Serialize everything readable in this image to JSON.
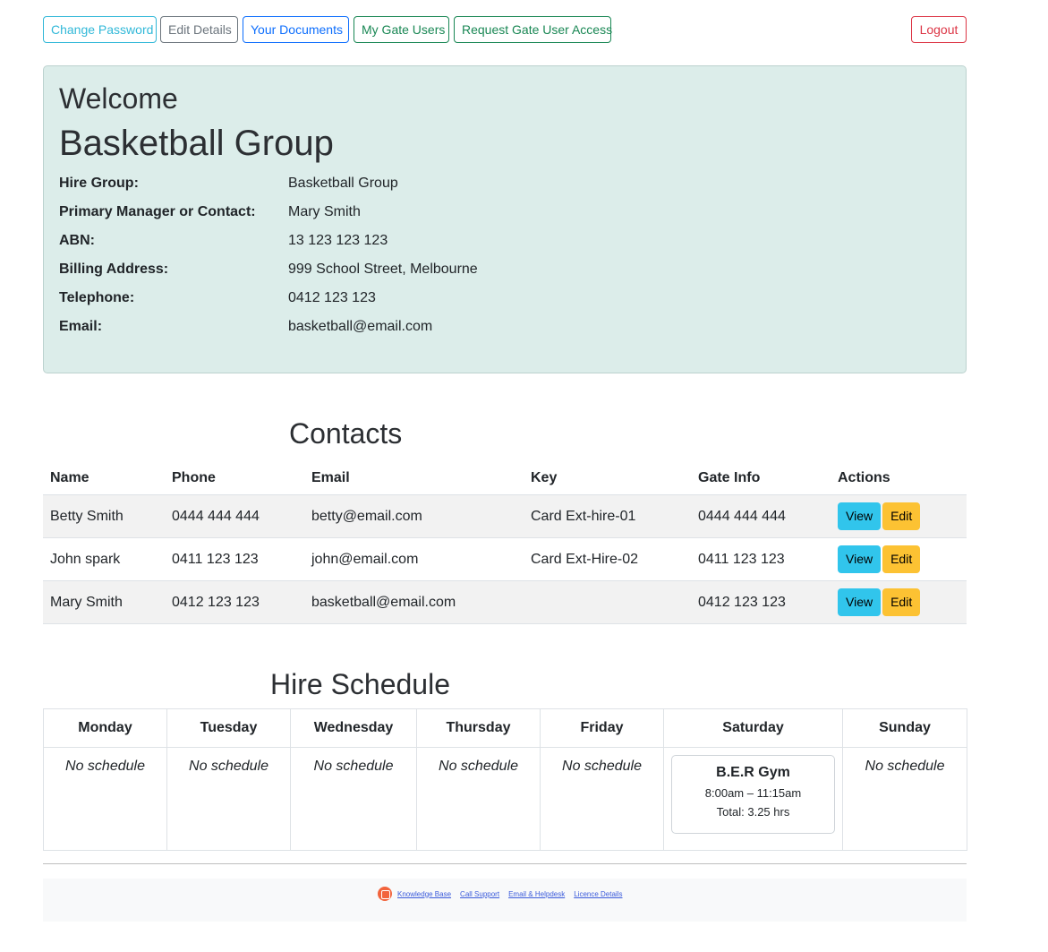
{
  "nav": {
    "change_password": "Change Password",
    "edit_details": "Edit Details",
    "your_documents": "Your Documents",
    "my_gate_users": "My Gate Users",
    "request_gate_access": "Request Gate User Access",
    "logout": "Logout"
  },
  "welcome": {
    "heading": "Welcome",
    "group_name": "Basketball Group",
    "fields": [
      {
        "label": "Hire Group:",
        "value": "Basketball Group"
      },
      {
        "label": "Primary Manager or Contact:",
        "value": "Mary Smith"
      },
      {
        "label": "ABN:",
        "value": "13 123 123 123"
      },
      {
        "label": "Billing Address:",
        "value": "999 School Street, Melbourne"
      },
      {
        "label": "Telephone:",
        "value": "0412 123 123"
      },
      {
        "label": "Email:",
        "value": "basketball@email.com"
      }
    ]
  },
  "contacts": {
    "title": "Contacts",
    "headers": [
      "Name",
      "Phone",
      "Email",
      "Key",
      "Gate Info",
      "Actions"
    ],
    "rows": [
      {
        "name": "Betty Smith",
        "phone": "0444 444 444",
        "email": "betty@email.com",
        "key": "Card Ext-hire-01",
        "gate": "0444 444 444"
      },
      {
        "name": "John spark",
        "phone": "0411 123 123",
        "email": "john@email.com",
        "key": "Card Ext-Hire-02",
        "gate": "0411 123 123"
      },
      {
        "name": "Mary Smith",
        "phone": "0412 123 123",
        "email": "basketball@email.com",
        "key": "",
        "gate": "0412 123 123"
      }
    ],
    "view_label": "View",
    "edit_label": "Edit"
  },
  "schedule": {
    "title": "Hire Schedule",
    "days": [
      "Monday",
      "Tuesday",
      "Wednesday",
      "Thursday",
      "Friday",
      "Saturday",
      "Sunday"
    ],
    "no_schedule": "No schedule",
    "event": {
      "name": "B.E.R Gym",
      "time": "8:00am – 11:15am",
      "total": "Total: 3.25 hrs"
    }
  },
  "footer": {
    "links": [
      "Knowledge Base",
      "Call Support",
      "Email & Helpdesk",
      "Licence Details"
    ]
  }
}
